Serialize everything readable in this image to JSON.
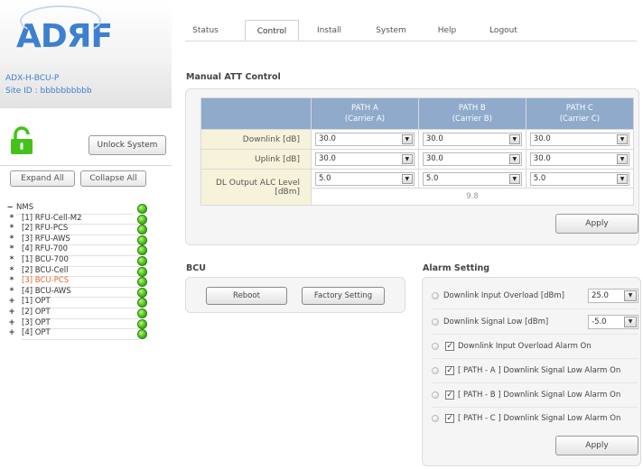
{
  "brand": {
    "logo_text": "ADЯF",
    "model": "ADX-H-BCU-P",
    "site_id": "Site ID : bbbbbbbbbb"
  },
  "left": {
    "unlock_label": "Unlock System",
    "expand_label": "Expand All",
    "collapse_label": "Collapse All",
    "tree": [
      {
        "sym": "−",
        "label": "NMS",
        "status": "green"
      },
      {
        "sym": "*",
        "label": "[1] RFU-Cell-M2",
        "status": "green"
      },
      {
        "sym": "*",
        "label": "[2] RFU-PCS",
        "status": "green"
      },
      {
        "sym": "*",
        "label": "[3] RFU-AWS",
        "status": "green"
      },
      {
        "sym": "*",
        "label": "[4] RFU-700",
        "status": "green"
      },
      {
        "sym": "*",
        "label": "[1] BCU-700",
        "status": "green"
      },
      {
        "sym": "*",
        "label": "[2] BCU-Cell",
        "status": "green"
      },
      {
        "sym": "*",
        "label": "[3] BCU-PCS",
        "status": "green",
        "active": true
      },
      {
        "sym": "*",
        "label": "[4] BCU-AWS",
        "status": "green"
      },
      {
        "sym": "+",
        "label": "[1] OPT",
        "status": "green"
      },
      {
        "sym": "+",
        "label": "[2] OPT",
        "status": "green"
      },
      {
        "sym": "+",
        "label": "[3] OPT",
        "status": "green"
      },
      {
        "sym": "+",
        "label": "[4] OPT",
        "status": "green"
      }
    ]
  },
  "nav": {
    "tabs": [
      "Status",
      "Control",
      "Install",
      "System",
      "Help",
      "Logout"
    ],
    "active": "Control"
  },
  "att": {
    "title": "Manual ATT Control",
    "paths": [
      {
        "name": "PATH A",
        "carrier": "(Carrier A)"
      },
      {
        "name": "PATH B",
        "carrier": "(Carrier B)"
      },
      {
        "name": "PATH C",
        "carrier": "(Carrier C)"
      }
    ],
    "rows": [
      {
        "label": "Downlink [dB]",
        "values": [
          "30.0",
          "30.0",
          "30.0"
        ]
      },
      {
        "label": "Uplink [dB]",
        "values": [
          "30.0",
          "30.0",
          "30.0"
        ]
      },
      {
        "label_line1": "DL Output ALC Level",
        "label_line2": "[dBm]",
        "values": [
          "5.0",
          "5.0",
          "5.0"
        ],
        "readout": "9.8"
      }
    ],
    "apply_label": "Apply"
  },
  "bcu": {
    "title": "BCU",
    "reboot_label": "Reboot",
    "factory_label": "Factory Setting"
  },
  "alarm": {
    "title": "Alarm Setting",
    "dl_overload_label": "Downlink Input Overload [dBm]",
    "dl_overload_value": "25.0",
    "dl_low_label": "Downlink Signal Low [dBm]",
    "dl_low_value": "-5.0",
    "checks": [
      "Downlink Input Overload Alarm On",
      "[ PATH - A ] Downlink Signal Low Alarm On",
      "[ PATH - B ] Downlink Signal Low Alarm On",
      "[ PATH - C ] Downlink Signal Low Alarm On"
    ],
    "apply_label": "Apply"
  },
  "colors": {
    "accent_blue": "#3d7fd0",
    "header_blue": "#8faacb",
    "label_yellow": "#f7f3da",
    "led_green": "#4cc71d",
    "active_orange": "#e0692a"
  }
}
